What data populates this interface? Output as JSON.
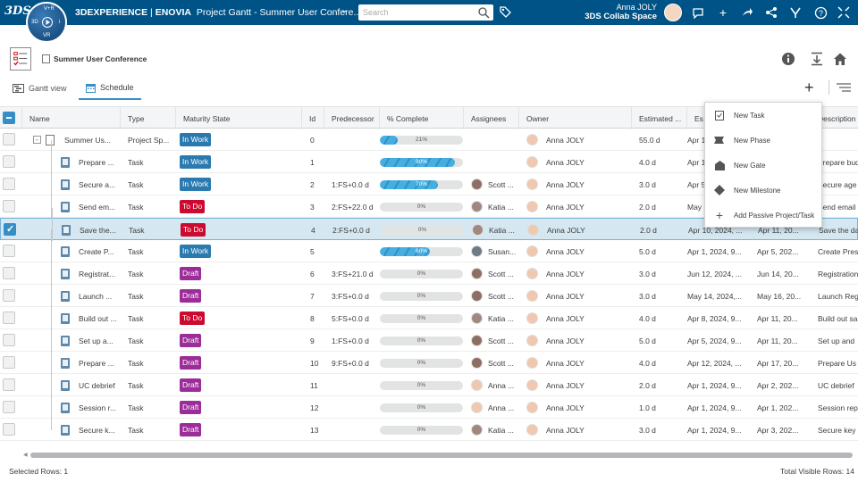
{
  "topbar": {
    "logo": "3DS",
    "brand_prefix": "3DEXPERIENCE",
    "brand_app": "ENOVIA",
    "brand_title": "Project Gantt - Summer User Confere...",
    "search_placeholder": "Search",
    "user_name": "Anna JOLY",
    "collab_space": "3DS Collab Space",
    "compass": {
      "n": "V+R",
      "w": "3D",
      "e": "i",
      "s": "VR"
    }
  },
  "header": {
    "project_title": "Summer User Conference"
  },
  "tabs": [
    {
      "label": "Gantt view"
    },
    {
      "label": "Schedule"
    }
  ],
  "grid": {
    "columns": [
      "Name",
      "Type",
      "Maturity State",
      "Id",
      "Predecessor",
      "% Complete",
      "Assignees",
      "Owner",
      "Estimated ...",
      "Es",
      "Description"
    ],
    "rows": [
      {
        "name": "Summer Us...",
        "type": "Project Sp...",
        "state": "In Work",
        "id": "0",
        "pred": "",
        "pct": 21,
        "pct_label": "21%",
        "assignee": "",
        "owner": "Anna JOLY",
        "est": "55.0 d",
        "start": "Apr 1",
        "finish": "",
        "desc": ""
      },
      {
        "name": "Prepare ...",
        "type": "Task",
        "state": "In Work",
        "id": "1",
        "pred": "",
        "pct": 90,
        "pct_label": "90%",
        "assignee": "",
        "owner": "Anna JOLY",
        "est": "4.0 d",
        "start": "Apr 1",
        "finish": "",
        "desc": "Prepare bud"
      },
      {
        "name": "Secure a...",
        "type": "Task",
        "state": "In Work",
        "id": "2",
        "pred": "1:FS+0.0 d",
        "pct": 70,
        "pct_label": "70%",
        "assignee": "Scott ...",
        "owner": "Anna JOLY",
        "est": "3.0 d",
        "start": "Apr 5",
        "finish": "",
        "desc": "Secure age"
      },
      {
        "name": "Send em...",
        "type": "Task",
        "state": "To Do",
        "id": "3",
        "pred": "2:FS+22.0 d",
        "pct": 0,
        "pct_label": "0%",
        "assignee": "Katia ...",
        "owner": "Anna JOLY",
        "est": "2.0 d",
        "start": "May",
        "finish": "",
        "desc": "Send email"
      },
      {
        "name": "Save the...",
        "type": "Task",
        "state": "To Do",
        "id": "4",
        "pred": "2:FS+0.0 d",
        "pct": 0,
        "pct_label": "0%",
        "assignee": "Katia ...",
        "owner": "Anna JOLY",
        "est": "2.0 d",
        "start": "Apr 10, 2024, ...",
        "finish": "Apr 11, 20...",
        "desc": "Save the da"
      },
      {
        "name": "Create P...",
        "type": "Task",
        "state": "In Work",
        "id": "5",
        "pred": "",
        "pct": 60,
        "pct_label": "60%",
        "assignee": "Susan...",
        "owner": "Anna JOLY",
        "est": "5.0 d",
        "start": "Apr 1, 2024, 9...",
        "finish": "Apr 5, 202...",
        "desc": "Create Pres"
      },
      {
        "name": "Registrat...",
        "type": "Task",
        "state": "Draft",
        "id": "6",
        "pred": "3:FS+21.0 d",
        "pct": 0,
        "pct_label": "0%",
        "assignee": "Scott ...",
        "owner": "Anna JOLY",
        "est": "3.0 d",
        "start": "Jun 12, 2024, ...",
        "finish": "Jun 14, 20...",
        "desc": "Registration"
      },
      {
        "name": "Launch ...",
        "type": "Task",
        "state": "Draft",
        "id": "7",
        "pred": "3:FS+0.0 d",
        "pct": 0,
        "pct_label": "0%",
        "assignee": "Scott ...",
        "owner": "Anna JOLY",
        "est": "3.0 d",
        "start": "May 14, 2024,...",
        "finish": "May 16, 20...",
        "desc": "Launch Reg"
      },
      {
        "name": "Build out ...",
        "type": "Task",
        "state": "To Do",
        "id": "8",
        "pred": "5:FS+0.0 d",
        "pct": 0,
        "pct_label": "0%",
        "assignee": "Katia ...",
        "owner": "Anna JOLY",
        "est": "4.0 d",
        "start": "Apr 8, 2024, 9...",
        "finish": "Apr 11, 20...",
        "desc": "Build out sa"
      },
      {
        "name": "Set up a...",
        "type": "Task",
        "state": "Draft",
        "id": "9",
        "pred": "1:FS+0.0 d",
        "pct": 0,
        "pct_label": "0%",
        "assignee": "Scott ...",
        "owner": "Anna JOLY",
        "est": "5.0 d",
        "start": "Apr 5, 2024, 9...",
        "finish": "Apr 11, 20...",
        "desc": "Set up and"
      },
      {
        "name": "Prepare ...",
        "type": "Task",
        "state": "Draft",
        "id": "10",
        "pred": "9:FS+0.0 d",
        "pct": 0,
        "pct_label": "0%",
        "assignee": "Scott ...",
        "owner": "Anna JOLY",
        "est": "4.0 d",
        "start": "Apr 12, 2024, ...",
        "finish": "Apr 17, 20...",
        "desc": "Prepare Us"
      },
      {
        "name": "UC debrief",
        "type": "Task",
        "state": "Draft",
        "id": "11",
        "pred": "",
        "pct": 0,
        "pct_label": "0%",
        "assignee": "Anna ...",
        "owner": "Anna JOLY",
        "est": "2.0 d",
        "start": "Apr 1, 2024, 9...",
        "finish": "Apr 2, 202...",
        "desc": "UC debrief"
      },
      {
        "name": "Session r...",
        "type": "Task",
        "state": "Draft",
        "id": "12",
        "pred": "",
        "pct": 0,
        "pct_label": "0%",
        "assignee": "Anna ...",
        "owner": "Anna JOLY",
        "est": "1.0 d",
        "start": "Apr 1, 2024, 9...",
        "finish": "Apr 1, 202...",
        "desc": "Session rep"
      },
      {
        "name": "Secure k...",
        "type": "Task",
        "state": "Draft",
        "id": "13",
        "pred": "",
        "pct": 0,
        "pct_label": "0%",
        "assignee": "Katia ...",
        "owner": "Anna JOLY",
        "est": "3.0 d",
        "start": "Apr 1, 2024, 9...",
        "finish": "Apr 3, 202...",
        "desc": "Secure key"
      }
    ],
    "selected_row": 4
  },
  "state_colors": {
    "In Work": "#2a7ab0",
    "To Do": "#cc092f",
    "Draft": "#9b2c98"
  },
  "menu": {
    "items": [
      {
        "label": "New Task",
        "icon": "task-icon"
      },
      {
        "label": "New Phase",
        "icon": "phase-icon"
      },
      {
        "label": "New Gate",
        "icon": "gate-icon"
      },
      {
        "label": "New Milestone",
        "icon": "milestone-icon"
      },
      {
        "label": "Add Passive Project/Task",
        "icon": "plus-icon"
      }
    ]
  },
  "status": {
    "selected_rows": "Selected Rows: 1",
    "total_visible_rows": "Total Visible Rows: 14"
  }
}
